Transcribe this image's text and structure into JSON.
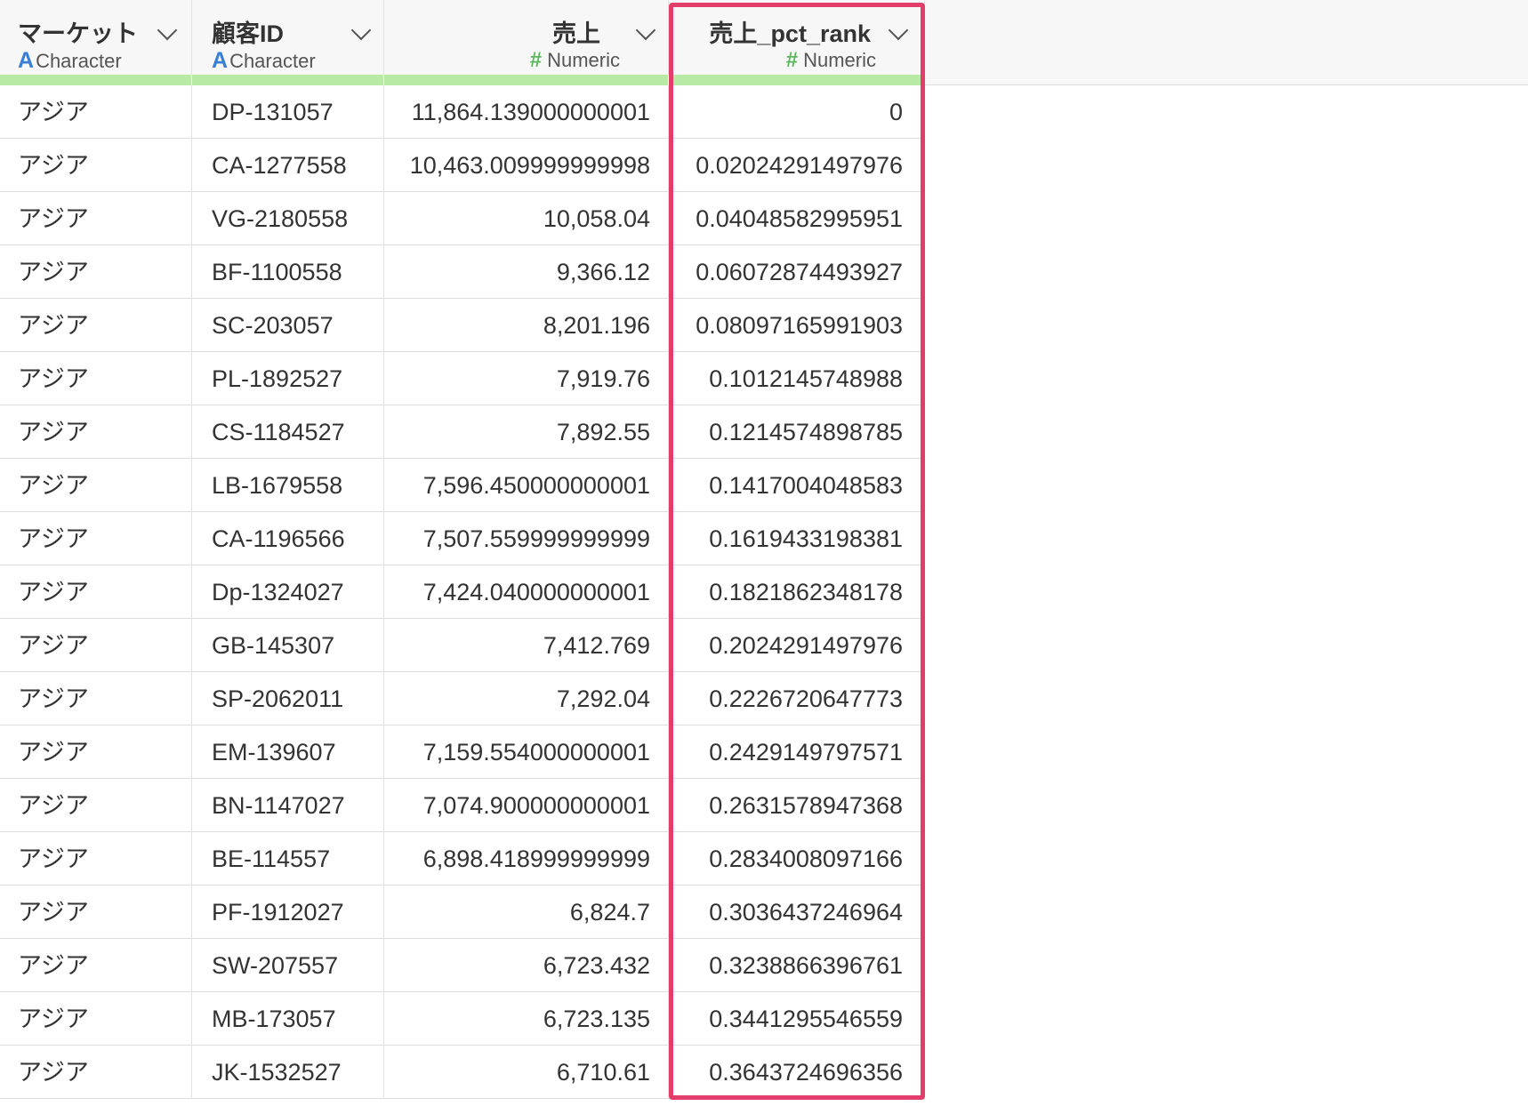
{
  "columns": [
    {
      "name": "マーケット",
      "type_glyph": "A",
      "type_label": "Character"
    },
    {
      "name": "顧客ID",
      "type_glyph": "A",
      "type_label": "Character"
    },
    {
      "name": "売上",
      "type_glyph": "#",
      "type_label": "Numeric"
    },
    {
      "name": "売上_pct_rank",
      "type_glyph": "#",
      "type_label": "Numeric"
    }
  ],
  "highlight_color": "#e23d6b",
  "header_accent_color": "#b8eaa6",
  "rows": [
    [
      "アジア",
      "DP-131057",
      "11,864.139000000001",
      "0"
    ],
    [
      "アジア",
      "CA-1277558",
      "10,463.009999999998",
      "0.02024291497976"
    ],
    [
      "アジア",
      "VG-2180558",
      "10,058.04",
      "0.04048582995951"
    ],
    [
      "アジア",
      "BF-1100558",
      "9,366.12",
      "0.06072874493927"
    ],
    [
      "アジア",
      "SC-203057",
      "8,201.196",
      "0.08097165991903"
    ],
    [
      "アジア",
      "PL-1892527",
      "7,919.76",
      "0.1012145748988"
    ],
    [
      "アジア",
      "CS-1184527",
      "7,892.55",
      "0.1214574898785"
    ],
    [
      "アジア",
      "LB-1679558",
      "7,596.450000000001",
      "0.1417004048583"
    ],
    [
      "アジア",
      "CA-1196566",
      "7,507.559999999999",
      "0.1619433198381"
    ],
    [
      "アジア",
      "Dp-1324027",
      "7,424.040000000001",
      "0.1821862348178"
    ],
    [
      "アジア",
      "GB-145307",
      "7,412.769",
      "0.2024291497976"
    ],
    [
      "アジア",
      "SP-2062011",
      "7,292.04",
      "0.2226720647773"
    ],
    [
      "アジア",
      "EM-139607",
      "7,159.554000000001",
      "0.2429149797571"
    ],
    [
      "アジア",
      "BN-1147027",
      "7,074.900000000001",
      "0.2631578947368"
    ],
    [
      "アジア",
      "BE-114557",
      "6,898.418999999999",
      "0.2834008097166"
    ],
    [
      "アジア",
      "PF-1912027",
      "6,824.7",
      "0.3036437246964"
    ],
    [
      "アジア",
      "SW-207557",
      "6,723.432",
      "0.3238866396761"
    ],
    [
      "アジア",
      "MB-173057",
      "6,723.135",
      "0.3441295546559"
    ],
    [
      "アジア",
      "JK-1532527",
      "6,710.61",
      "0.3643724696356"
    ]
  ]
}
